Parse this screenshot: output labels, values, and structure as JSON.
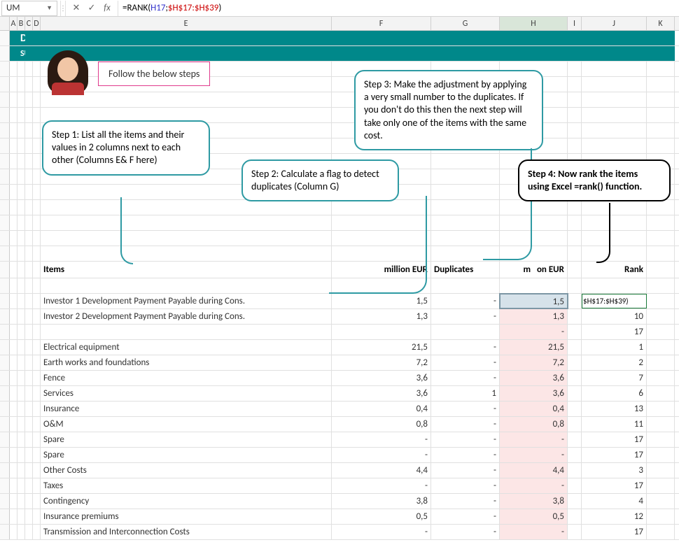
{
  "formula_bar": {
    "name_box": "UM",
    "cancel_glyph": "✕",
    "enter_glyph": "✓",
    "fx_glyph": "fx",
    "formula_eq": "=",
    "formula_fn": "RANK(",
    "formula_ref1": "H17",
    "formula_sep": ";",
    "formula_abs": "$H$17:$H$39",
    "formula_close": ")"
  },
  "columns": {
    "A": "A",
    "B": "B",
    "C": "C",
    "D": "D",
    "E": "E",
    "F": "F",
    "G": "G",
    "H": "H",
    "I": "I",
    "J": "J",
    "K": "K"
  },
  "header": {
    "title": "DataGraph",
    "subtitle": "SUMMARY SOURCES AND USES OF FUNDS"
  },
  "pink_bubble": "Follow the below steps",
  "callouts": {
    "step1": "Step 1: List all the items and their values in 2 columns next to each other (Columns E& F here)",
    "step2": "Step 2: Calculate a flag to detect duplicates (Column G)",
    "step3": "Step 3: Make the adjustment by applying a very small number to the duplicates. If you don't do this then the next step will take only one of the items with the same cost.",
    "step4": "Step 4: Now rank the items using Excel =rank() function."
  },
  "table": {
    "headers": {
      "items": "Items",
      "million_eur": "million EUR",
      "duplicates": "Duplicates",
      "h_header_fragment": "on EUR",
      "h_header_prefix": "m",
      "rank": "Rank"
    },
    "j17_display": "$H$17:$H$39)",
    "dash": "-",
    "rows": [
      {
        "item": "Investor 1 Development Payment Payable during Cons.",
        "f": "1,5",
        "g": "-",
        "h": "1,5",
        "j": ""
      },
      {
        "item": "Investor 2 Development Payment Payable during Cons.",
        "f": "1,3",
        "g": "-",
        "h": "1,3",
        "j": "10"
      },
      {
        "item": "",
        "f": "",
        "g": "",
        "h": "-",
        "j": "17"
      },
      {
        "item": "Electrical equipment",
        "f": "21,5",
        "g": "-",
        "h": "21,5",
        "j": "1"
      },
      {
        "item": "Earth works and foundations",
        "f": "7,2",
        "g": "-",
        "h": "7,2",
        "j": "2"
      },
      {
        "item": "Fence",
        "f": "3,6",
        "g": "-",
        "h": "3,6",
        "j": "7"
      },
      {
        "item": "Services",
        "f": "3,6",
        "g": "1",
        "h": "3,6",
        "j": "6"
      },
      {
        "item": "Insurance",
        "f": "0,4",
        "g": "-",
        "h": "0,4",
        "j": "13"
      },
      {
        "item": "O&M",
        "f": "0,8",
        "g": "-",
        "h": "0,8",
        "j": "11"
      },
      {
        "item": "Spare",
        "f": "-",
        "g": "-",
        "h": "-",
        "j": "17"
      },
      {
        "item": "Spare",
        "f": "-",
        "g": "-",
        "h": "-",
        "j": "17"
      },
      {
        "item": "Other Costs",
        "f": "4,4",
        "g": "-",
        "h": "4,4",
        "j": "3"
      },
      {
        "item": "Taxes",
        "f": "-",
        "g": "-",
        "h": "-",
        "j": "17"
      },
      {
        "item": "Contingency",
        "f": "3,8",
        "g": "-",
        "h": "3,8",
        "j": "4"
      },
      {
        "item": "Insurance premiums",
        "f": "0,5",
        "g": "-",
        "h": "0,5",
        "j": "12"
      },
      {
        "item": "Transmission and Interconnection Costs",
        "f": "-",
        "g": "-",
        "h": "-",
        "j": "17"
      }
    ]
  }
}
